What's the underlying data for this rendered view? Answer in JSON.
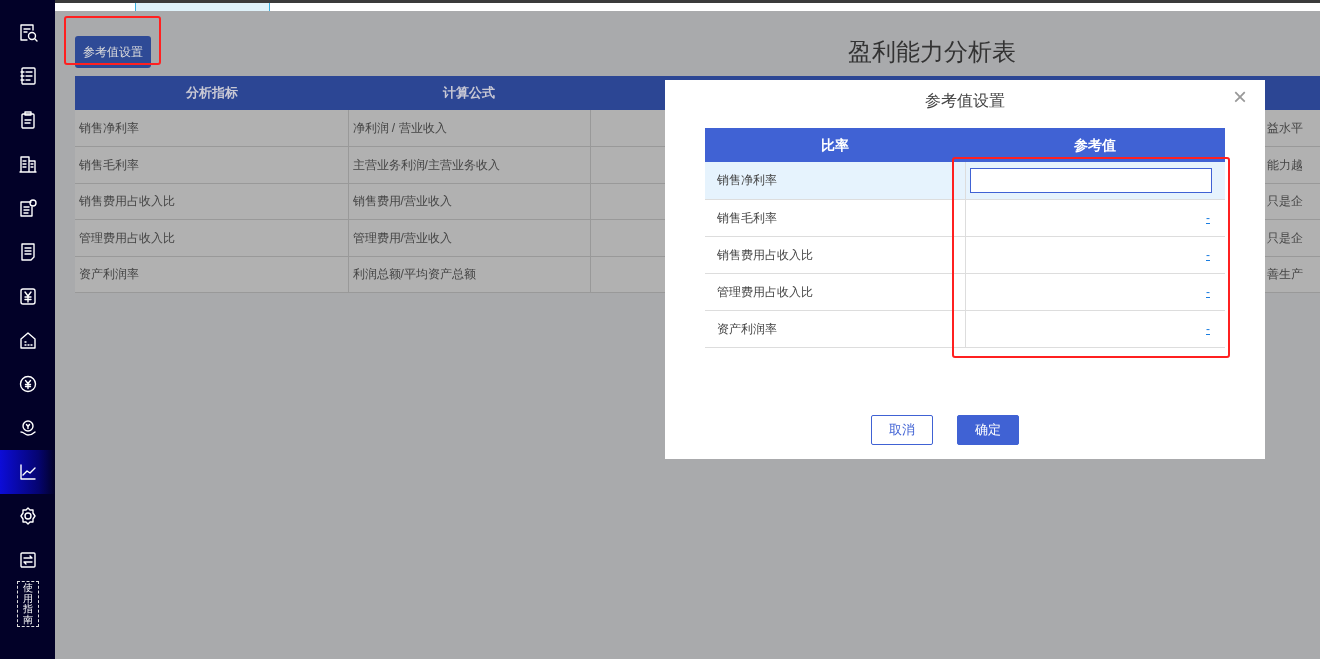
{
  "sidebar": {
    "items": [
      {
        "kind": "icon",
        "selected": false
      },
      {
        "kind": "icon",
        "selected": false
      },
      {
        "kind": "icon",
        "selected": false
      },
      {
        "kind": "icon",
        "selected": false
      },
      {
        "kind": "icon",
        "selected": false
      },
      {
        "kind": "icon",
        "selected": false
      },
      {
        "kind": "icon",
        "selected": false
      },
      {
        "kind": "icon",
        "selected": false
      },
      {
        "kind": "icon",
        "selected": false
      },
      {
        "kind": "icon",
        "selected": false
      },
      {
        "kind": "icon",
        "selected": true
      },
      {
        "kind": "icon",
        "selected": false
      },
      {
        "kind": "icon",
        "selected": false
      },
      {
        "kind": "text",
        "label": "使用指南",
        "selected": false
      }
    ]
  },
  "page": {
    "settings_button": "参考值设置",
    "title": "盈利能力分析表",
    "table": {
      "columns": [
        "分析指标",
        "计算公式"
      ],
      "rows": [
        {
          "indicator": "销售净利率",
          "formula": "净利润 / 营业收入",
          "note": "益水平"
        },
        {
          "indicator": "销售毛利率",
          "formula": "主营业务利润/主营业务收入",
          "note": "能力越"
        },
        {
          "indicator": "销售费用占收入比",
          "formula": "销售费用/营业收入",
          "note": "只是企"
        },
        {
          "indicator": "管理费用占收入比",
          "formula": "管理费用/营业收入",
          "note": "只是企"
        },
        {
          "indicator": "资产利润率",
          "formula": "利润总额/平均资产总额",
          "note": "善生产"
        }
      ]
    }
  },
  "dialog": {
    "title": "参考值设置",
    "close": "×",
    "columns": [
      "比率",
      "参考值"
    ],
    "rows": [
      {
        "name": "销售净利率",
        "editing": true,
        "selected": true
      },
      {
        "name": "销售毛利率",
        "editing": false,
        "selected": false,
        "value": "-"
      },
      {
        "name": "销售费用占收入比",
        "editing": false,
        "selected": false,
        "value": "-"
      },
      {
        "name": "管理费用占收入比",
        "editing": false,
        "selected": false,
        "value": "-"
      },
      {
        "name": "资产利润率",
        "editing": false,
        "selected": false,
        "value": "-"
      }
    ],
    "buttons": [
      {
        "label": "取消",
        "kind": "secondary"
      },
      {
        "label": "确定",
        "kind": "primary"
      }
    ]
  }
}
